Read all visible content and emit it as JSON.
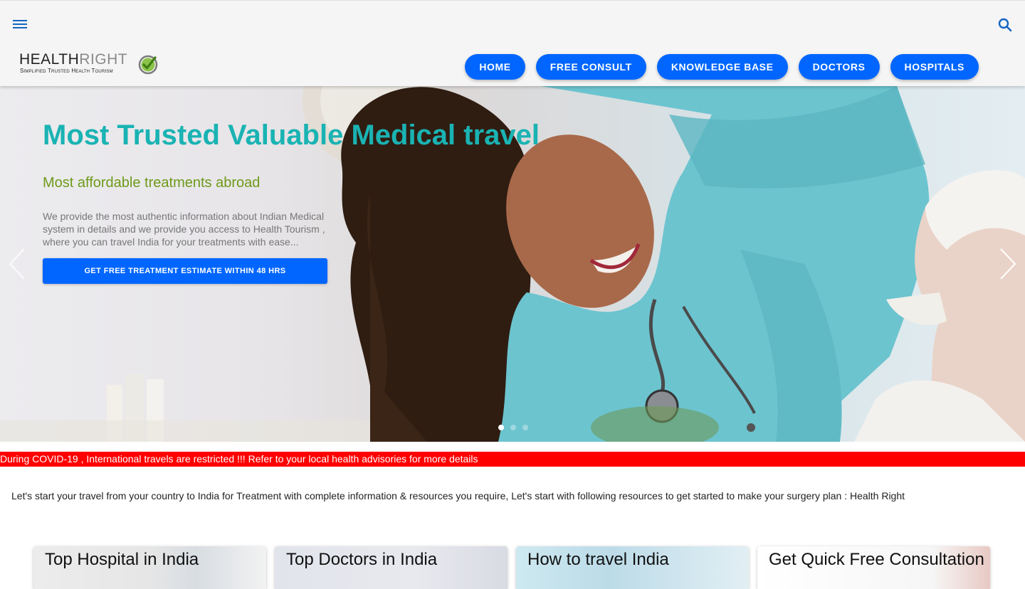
{
  "header": {
    "menu_icon": "hamburger-menu-icon",
    "search_icon": "search-icon",
    "logo": {
      "word_dark": "HEALTH",
      "word_light": "RIGHT",
      "tagline": "Simplified Trusted Health Tourism"
    },
    "nav": [
      {
        "label": "HOME"
      },
      {
        "label": "FREE CONSULT"
      },
      {
        "label": "KNOWLEDGE BASE"
      },
      {
        "label": "DOCTORS"
      },
      {
        "label": "HOSPITALS"
      }
    ]
  },
  "hero": {
    "title": "Most Trusted Valuable Medical travel",
    "subtitle": "Most affordable treatments abroad",
    "description": "We provide the most authentic information about Indian Medical system in details and we provide you access to Health Tourism , where you can travel India for your treatments with ease...",
    "cta_label": "GET FREE TREATMENT ESTIMATE WITHIN 48 HRS",
    "slide_count": 3,
    "active_slide": 1
  },
  "alert": {
    "text": "During COVID-19 , International travels are restricted !!! Refer to your local health advisories for more details"
  },
  "intro": {
    "text": "Let's start your travel from your country to India for Treatment with complete information & resources you require, Let's start with following resources to get started to make your surgery plan : Health Right"
  },
  "cards": [
    {
      "title": "Top Hospital in India"
    },
    {
      "title": "Top Doctors in India"
    },
    {
      "title": "How to travel India"
    },
    {
      "title": "Get Quick Free Consultation"
    }
  ],
  "colors": {
    "primary": "#0066ff",
    "hero_title": "#1ab3b3",
    "hero_subtitle": "#6e9a1a",
    "alert_bg": "#ff0000"
  }
}
